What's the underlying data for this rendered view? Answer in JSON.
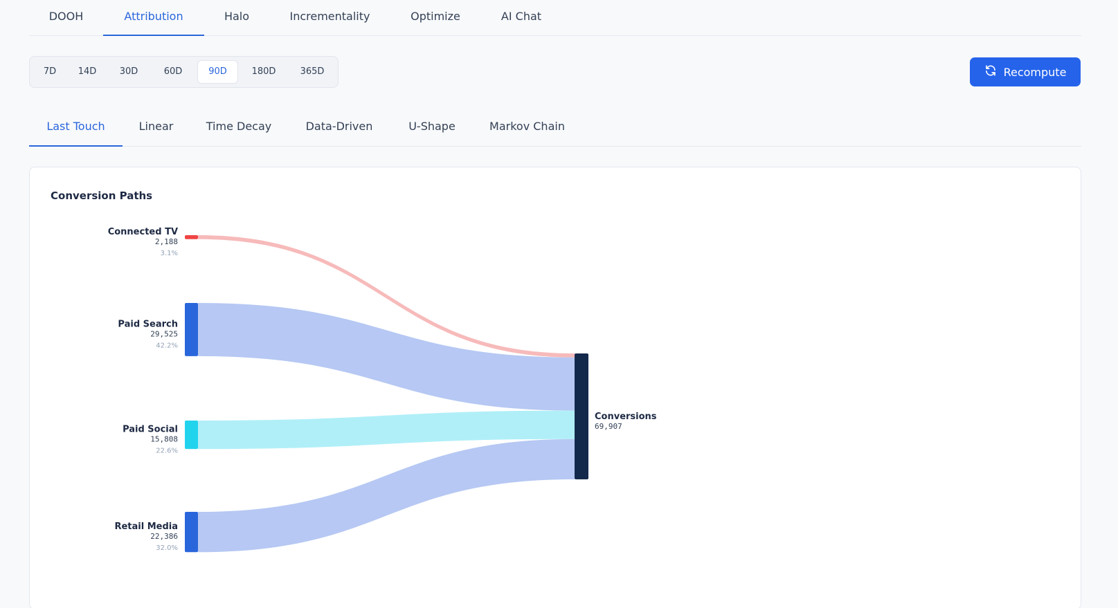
{
  "top_nav": {
    "tabs": [
      {
        "label": "DOOH",
        "active": false
      },
      {
        "label": "Attribution",
        "active": true
      },
      {
        "label": "Halo",
        "active": false
      },
      {
        "label": "Incrementality",
        "active": false
      },
      {
        "label": "Optimize",
        "active": false
      },
      {
        "label": "AI Chat",
        "active": false
      }
    ]
  },
  "range_selector": {
    "options": [
      "7D",
      "14D",
      "30D",
      "60D",
      "90D",
      "180D",
      "365D"
    ],
    "selected": "90D"
  },
  "recompute": {
    "label": "Recompute",
    "icon": "refresh-icon"
  },
  "model_tabs": {
    "tabs": [
      {
        "label": "Last Touch",
        "active": true
      },
      {
        "label": "Linear",
        "active": false
      },
      {
        "label": "Time Decay",
        "active": false
      },
      {
        "label": "Data-Driven",
        "active": false
      },
      {
        "label": "U-Shape",
        "active": false
      },
      {
        "label": "Markov Chain",
        "active": false
      }
    ]
  },
  "card": {
    "title": "Conversion Paths"
  },
  "colors": {
    "accent": "#2563eb",
    "connected_tv": "#ef4444",
    "paid_search": "#2a66db",
    "paid_social": "#22d3ee",
    "retail_media": "#2a66db",
    "conversions": "#13294b"
  },
  "chart_data": {
    "type": "sankey",
    "sources": [
      {
        "name": "Connected TV",
        "value": 2188,
        "value_label": "2,188",
        "share_label": "3.1%",
        "color": "#ef4444",
        "link_color": "#f7baba"
      },
      {
        "name": "Paid Search",
        "value": 29525,
        "value_label": "29,525",
        "share_label": "42.2%",
        "color": "#2a66db",
        "link_color": "#b6c8f3"
      },
      {
        "name": "Paid Social",
        "value": 15808,
        "value_label": "15,808",
        "share_label": "22.6%",
        "color": "#22d3ee",
        "link_color": "#b0eff8"
      },
      {
        "name": "Retail Media",
        "value": 22386,
        "value_label": "22,386",
        "share_label": "32.0%",
        "color": "#2a66db",
        "link_color": "#b6c8f3"
      }
    ],
    "target": {
      "name": "Conversions",
      "value": 69907,
      "value_label": "69,907",
      "color": "#13294b"
    }
  }
}
